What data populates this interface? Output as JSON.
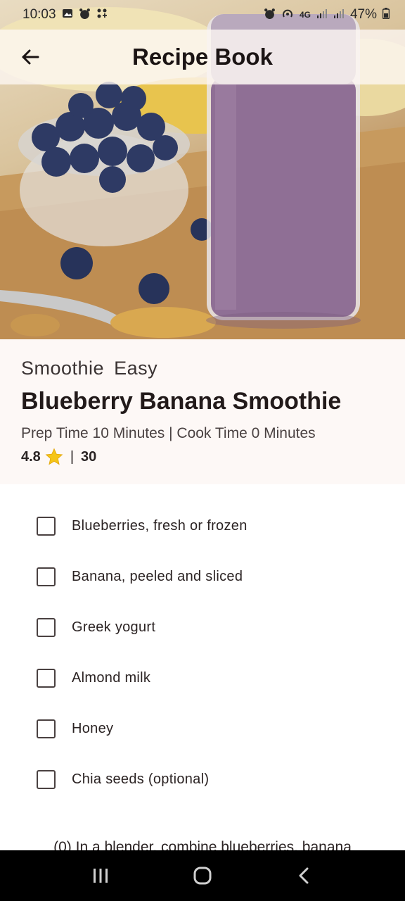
{
  "status_bar": {
    "time": "10:03",
    "network": "4G",
    "battery": "47%",
    "left_icons": [
      "image-icon",
      "alarm-icon",
      "apps-grid-icon"
    ],
    "right_icons": [
      "alarm-icon",
      "hotspot-icon",
      "signal-icon",
      "signal-icon",
      "battery-icon"
    ]
  },
  "app_bar": {
    "title": "Recipe Book",
    "back_icon": "arrow-left-icon"
  },
  "hero": {
    "subject": "blueberry-smoothie-photo"
  },
  "recipe": {
    "category": "Smoothie",
    "difficulty": "Easy",
    "title": "Blueberry Banana Smoothie",
    "prep_time": "Prep Time 10 Minutes |",
    "cook_time": "Cook Time 0 Minutes",
    "rating": "4.8",
    "rating_icon": "star-icon",
    "separator": "|",
    "count": "30"
  },
  "ingredients": [
    {
      "label": "Blueberries, fresh or frozen",
      "checked": false
    },
    {
      "label": "Banana, peeled and sliced",
      "checked": false
    },
    {
      "label": "Greek yogurt",
      "checked": false
    },
    {
      "label": "Almond milk",
      "checked": false
    },
    {
      "label": "Honey",
      "checked": false
    },
    {
      "label": "Chia seeds (optional)",
      "checked": false
    }
  ],
  "steps": {
    "first_partial": "(0) In a blender, combine blueberries, banana"
  },
  "nav_bar": {
    "buttons": [
      "recent-apps-icon",
      "home-icon",
      "back-icon"
    ]
  },
  "colors": {
    "app_bar_bg": "#fdf6f2",
    "info_bg": "#fdf8f6",
    "text_primary": "#221a1a",
    "star": "#f5c518",
    "nav_bg": "#000000"
  }
}
